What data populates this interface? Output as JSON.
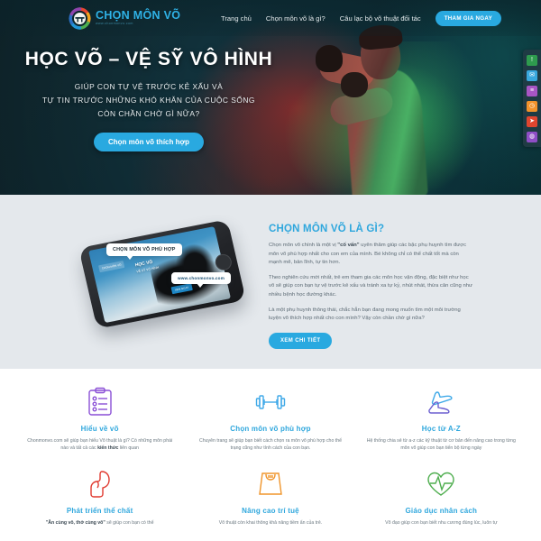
{
  "nav": {
    "logo_text": "CHỌN MÔN VÕ",
    "logo_sub": "www.chonmonvo.com",
    "links": [
      {
        "label": "Trang chủ"
      },
      {
        "label": "Chọn môn võ là gì?"
      },
      {
        "label": "Câu lạc bộ võ thuật đối tác"
      }
    ],
    "cta_label": "THAM GIA NGAY"
  },
  "hero": {
    "title": "HỌC VÕ – VỆ SỸ VÔ HÌNH",
    "sub_line1": "GIÚP CON TỰ VỆ TRƯỚC KẺ XẤU VÀ",
    "sub_line2": "TỰ TIN TRƯỚC NHỮNG KHÓ KHĂN CỦA CUỘC SỐNG",
    "sub_line3": "CÒN CHẦN CHỜ GÌ NỮA?",
    "cta_label": "Chọn môn võ thích hợp"
  },
  "sidebar": {
    "icons": [
      {
        "name": "info-icon",
        "glyph": "!",
        "color": "#2e9b4e"
      },
      {
        "name": "message-icon",
        "glyph": "✉",
        "color": "#39a8dd"
      },
      {
        "name": "list-icon",
        "glyph": "≡",
        "color": "#a855c4"
      },
      {
        "name": "clock-icon",
        "glyph": "◷",
        "color": "#f0922b"
      },
      {
        "name": "share-icon",
        "glyph": "➤",
        "color": "#e0452f"
      },
      {
        "name": "chat-icon",
        "glyph": "◍",
        "color": "#8e4ec6"
      }
    ]
  },
  "about": {
    "phone_callout_1": "CHỌN MÔN VÕ PHÙ HỢP",
    "phone_callout_2": "www.chonmonvo.com",
    "phone_screen_title": "HỌC VÕ",
    "phone_screen_sub": "VỆ SỸ VÔ HÌNH",
    "phone_badge": "CHỌN MÔN VÕ",
    "phone_chip": "XEM NGAY",
    "title": "CHỌN MÔN VÕ LÀ GÌ?",
    "p1_a": "Chọn môn võ chính là một vị ",
    "p1_b": "\"cố vấn\"",
    "p1_c": " uyên thâm giúp các bậc phụ huynh tìm được môn võ phù hợp nhất cho con em của mình. Bé không chỉ có thể chất tốt mà còn mạnh mẽ, bản lĩnh, tự tin hơn.",
    "p2": "Theo nghiên cứu mới nhất, trẻ em tham gia các môn học vận động, đặc biệt như học võ sẽ giúp con bạn tự vệ trước kẻ xấu và tránh xa tự kỷ, nhút nhát, thừa cân cũng như nhiều bệnh học đường khác.",
    "p3": "Là một phụ huynh thông thái, chắc hẳn bạn đang mong muốn tìm một môi trường luyện võ thích hợp nhất cho con mình? Vậy còn chần chờ gì nữa?",
    "btn_label": "XEM CHI TIẾT"
  },
  "features": [
    {
      "icon": "clipboard-icon",
      "color": "#8a4fd6",
      "title": "Hiểu về võ",
      "desc_a": "Chonmonvo.com sẽ giúp bạn hiểu Võ thuật là gì? Có những môn phái nào và tất cả các ",
      "desc_b": "kiến thức",
      "desc_c": " liên quan"
    },
    {
      "icon": "dumbbell-icon",
      "color": "#3fa9e8",
      "title": "Chọn môn võ phù hợp",
      "desc_a": "Chuyên trang sẽ giúp bạn biết cách chọn ra môn võ phù hợp cho thể trạng cũng như tính cách của con bạn.",
      "desc_b": "",
      "desc_c": ""
    },
    {
      "icon": "sneaker-icon",
      "color": "#5b6fd4",
      "title": "Học từ A-Z",
      "desc_a": "Hệ thống chia sẻ từ a-z các kỹ thuật từ cơ bản đến nâng cao trong từng môn võ giúp con bạn tiến bộ từng ngày",
      "desc_b": "",
      "desc_c": ""
    },
    {
      "icon": "bicep-icon",
      "color": "#e0392f",
      "title": "Phát triển thể chất",
      "desc_a": "",
      "desc_b": "\"Ăn cùng võ, thở cùng võ\"",
      "desc_c": " sẽ giúp con bạn có thể"
    },
    {
      "icon": "scale-icon",
      "color": "#f0952b",
      "title": "Nâng cao trí tuệ",
      "desc_a": "Võ thuật còn khai thông khả năng tiềm ẩn của trẻ.",
      "desc_b": "",
      "desc_c": ""
    },
    {
      "icon": "heartbeat-icon",
      "color": "#4fae4f",
      "title": "Giáo dục nhân cách",
      "desc_a": "Võ đạo giúp con bạn biết nhu cương đúng lúc, luôn tự",
      "desc_b": "",
      "desc_c": ""
    }
  ]
}
